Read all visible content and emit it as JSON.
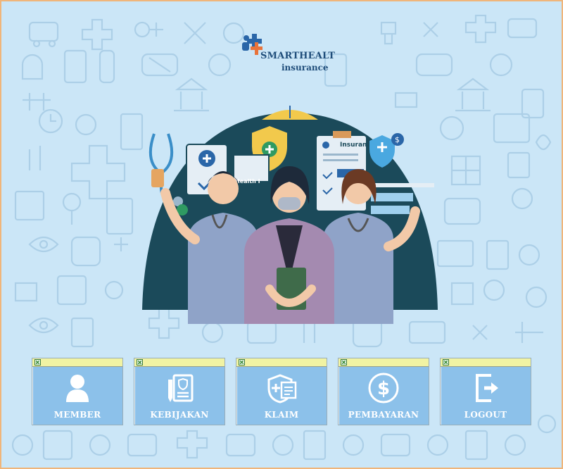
{
  "brand": {
    "title": "SMARTHEALT",
    "subtitle": "insurance"
  },
  "hero": {
    "clipboard_text": "Insurance",
    "screen_text": "Health I"
  },
  "menu": [
    {
      "key": "member",
      "label": "MEMBER",
      "icon": "person-icon"
    },
    {
      "key": "kebijakan",
      "label": "KEBIJAKAN",
      "icon": "policy-document-icon"
    },
    {
      "key": "klaim",
      "label": "KLAIM",
      "icon": "claim-shield-icon"
    },
    {
      "key": "pembayaran",
      "label": "PEMBAYARAN",
      "icon": "dollar-coin-icon"
    },
    {
      "key": "logout",
      "label": "LOGOUT",
      "icon": "exit-door-icon"
    }
  ],
  "colors": {
    "background": "#cbe6f7",
    "border": "#f0b57a",
    "button": "#8cc1ea",
    "button_bar": "#f1f3a3",
    "hero_dark": "#1b4a5a",
    "brand_text": "#1f4d7a"
  }
}
